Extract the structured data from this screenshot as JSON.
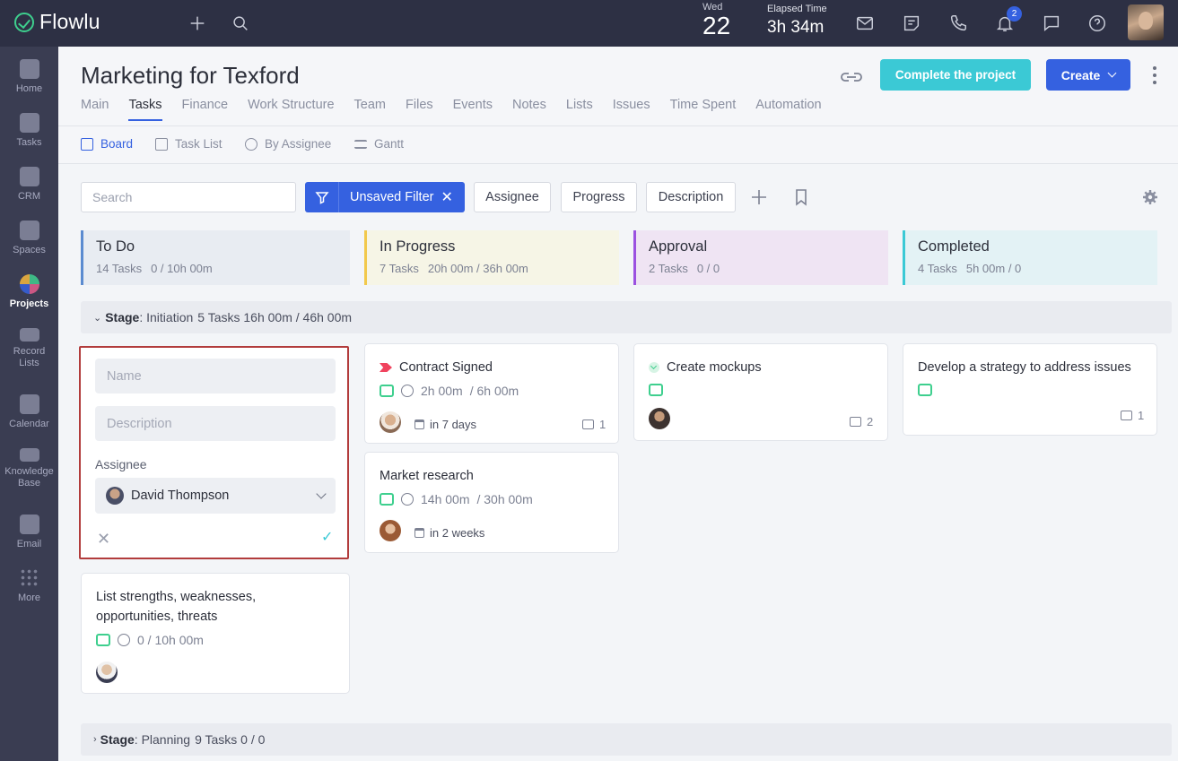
{
  "app": {
    "name": "Flowlu",
    "date_weekday": "Wed",
    "date_day": "22",
    "elapsed_label": "Elapsed Time",
    "elapsed_value": "3h 34m",
    "notification_count": "2"
  },
  "sidebar": {
    "items": [
      {
        "label": "Home"
      },
      {
        "label": "Tasks"
      },
      {
        "label": "CRM"
      },
      {
        "label": "Spaces"
      },
      {
        "label": "Projects"
      },
      {
        "label": "Record\nLists"
      },
      {
        "label": "Calendar"
      },
      {
        "label": "Knowledge\nBase"
      },
      {
        "label": "Email"
      },
      {
        "label": "More"
      }
    ]
  },
  "header": {
    "title": "Marketing for Texford",
    "complete_label": "Complete the project",
    "create_label": "Create",
    "tabs": [
      "Main",
      "Tasks",
      "Finance",
      "Work Structure",
      "Team",
      "Files",
      "Events",
      "Notes",
      "Lists",
      "Issues",
      "Time Spent",
      "Automation"
    ],
    "active_tab": "Tasks"
  },
  "views": {
    "items": [
      "Board",
      "Task List",
      "By Assignee",
      "Gantt"
    ],
    "active": "Board"
  },
  "filters": {
    "search_placeholder": "Search",
    "active_filter": "Unsaved Filter",
    "chips": [
      "Assignee",
      "Progress",
      "Description"
    ]
  },
  "columns": [
    {
      "title": "To Do",
      "count": "14 Tasks",
      "time": "0 / 10h 00m",
      "accent": "#5b8bd0",
      "bg": "#e8ecf2"
    },
    {
      "title": "In Progress",
      "count": "7 Tasks",
      "time": "20h 00m / 36h 00m",
      "accent": "#f2c94c",
      "bg": "#f6f5e6"
    },
    {
      "title": "Approval",
      "count": "2 Tasks",
      "time": "0 / 0",
      "accent": "#9b51e0",
      "bg": "#efe4f3"
    },
    {
      "title": "Completed",
      "count": "4 Tasks",
      "time": "5h 00m / 0",
      "accent": "#3bc9d5",
      "bg": "#e3f2f5"
    }
  ],
  "stages": [
    {
      "label": "Stage",
      "name": ": Initiation",
      "summary": "5 Tasks 16h 00m / 46h 00m"
    },
    {
      "label": "Stage",
      "name": ": Planning",
      "summary": "9 Tasks 0 / 0"
    }
  ],
  "new_task_form": {
    "name_placeholder": "Name",
    "description_placeholder": "Description",
    "assignee_label": "Assignee",
    "assignee_value": "David Thompson"
  },
  "cards": {
    "swot": {
      "title_line1": "List strengths, weaknesses,",
      "title_line2": "opportunities, threats",
      "time": "0 / 10h 00m"
    },
    "contract": {
      "title": "Contract Signed",
      "time": "2h 00m",
      "estimate": "/ 6h 00m",
      "due": "in 7 days",
      "comments": "1"
    },
    "market": {
      "title": "Market research",
      "time": "14h 00m",
      "estimate": "/ 30h 00m",
      "due": "in 2 weeks"
    },
    "mockups": {
      "title": "Create mockups",
      "comments": "2"
    },
    "strategy": {
      "title": "Develop a strategy to address issues",
      "comments": "1"
    }
  }
}
